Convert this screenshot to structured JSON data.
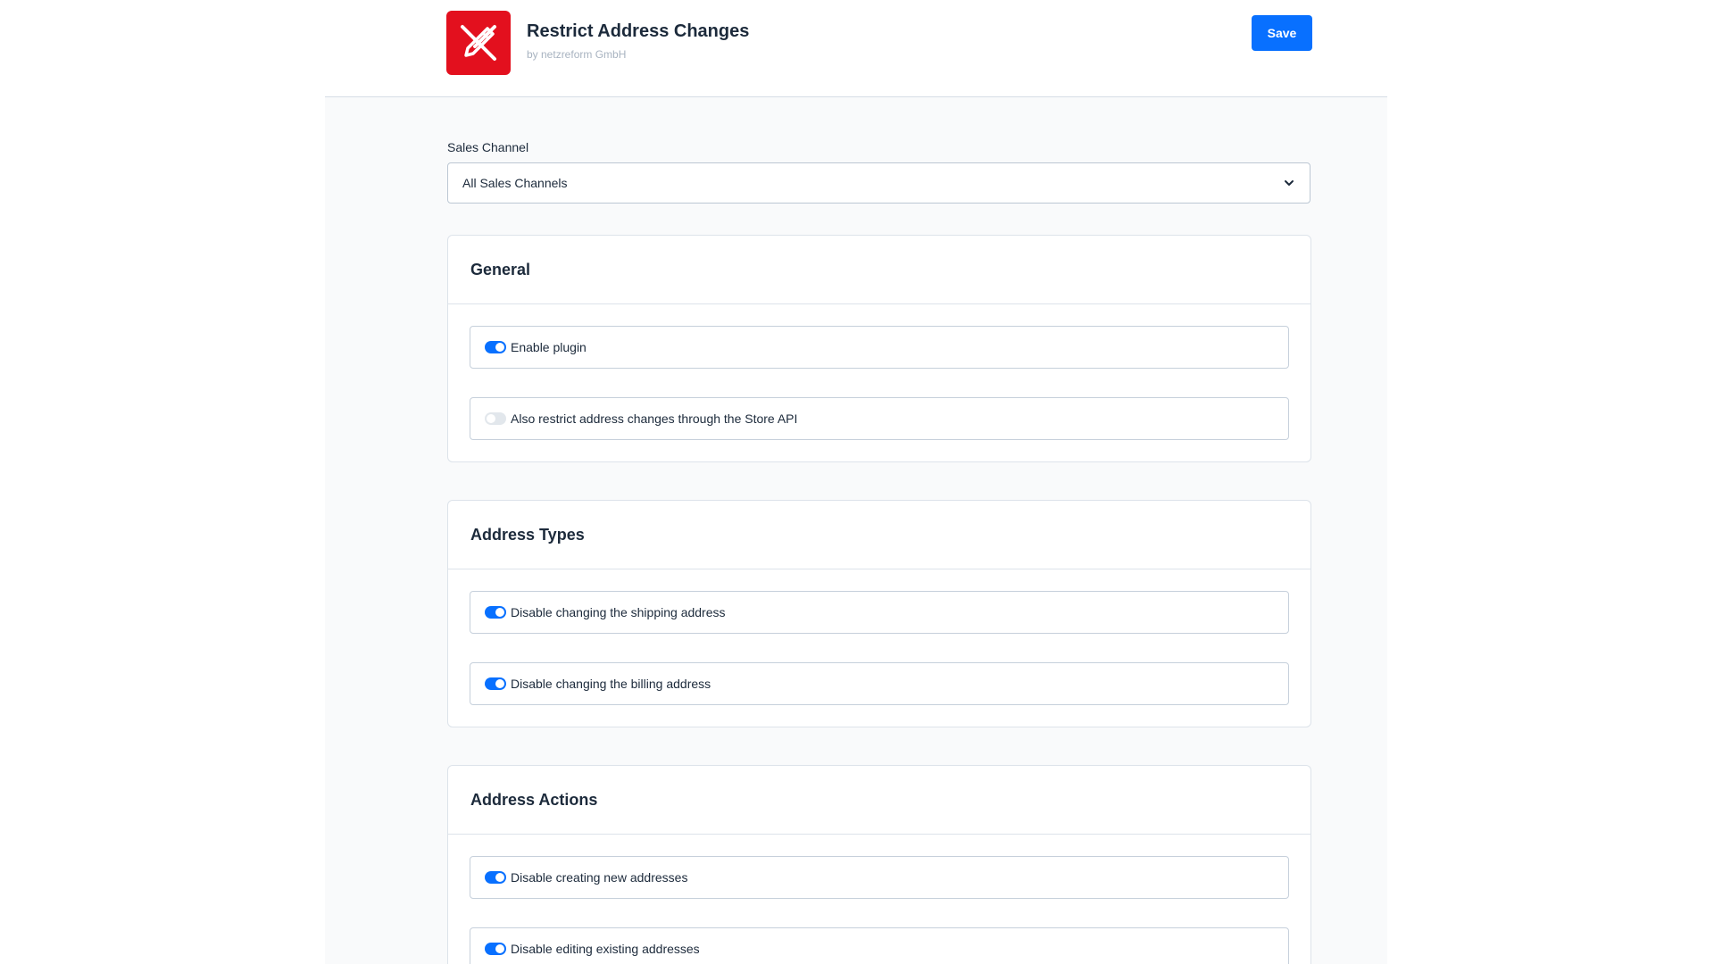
{
  "header": {
    "title": "Restrict Address Changes",
    "vendor": "by netzreform GmbH",
    "save_label": "Save",
    "logo_icon": "pen-cross-icon",
    "logo_color": "#e3101e"
  },
  "sales_channel": {
    "label": "Sales Channel",
    "selected": "All Sales Channels"
  },
  "sections": [
    {
      "title": "General",
      "options": [
        {
          "label": "Enable plugin",
          "enabled": true
        },
        {
          "label": "Also restrict address changes through the Store API",
          "enabled": false
        }
      ]
    },
    {
      "title": "Address Types",
      "options": [
        {
          "label": "Disable changing the shipping address",
          "enabled": true
        },
        {
          "label": "Disable changing the billing address",
          "enabled": true
        }
      ]
    },
    {
      "title": "Address Actions",
      "options": [
        {
          "label": "Disable creating new addresses",
          "enabled": true
        },
        {
          "label": "Disable editing existing addresses",
          "enabled": true
        }
      ]
    }
  ],
  "colors": {
    "accent": "#0870ff",
    "toggle_off": "#e2e7ec"
  }
}
